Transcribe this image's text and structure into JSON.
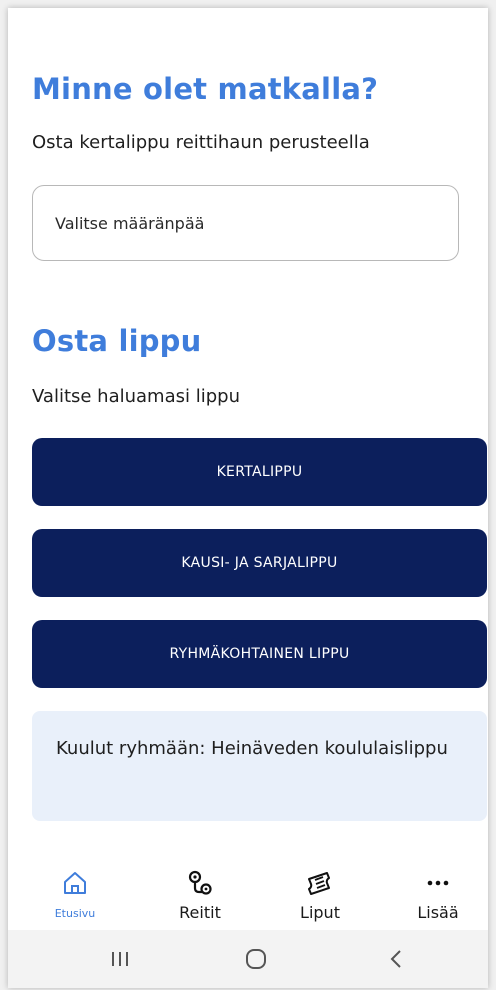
{
  "destination_section": {
    "title": "Minne olet matkalla?",
    "subtitle": "Osta kertalippu reittihaun perusteella",
    "input_placeholder": "Valitse määränpää"
  },
  "ticket_section": {
    "title": "Osta lippu",
    "subtitle": "Valitse haluamasi lippu",
    "buttons": [
      {
        "label": "KERTALIPPU"
      },
      {
        "label": "KAUSI- JA SARJALIPPU"
      },
      {
        "label": "RYHMÄKOHTAINEN LIPPU"
      }
    ],
    "group_info": "Kuulut ryhmään: Heinäveden koululaislippu"
  },
  "bottom_nav": {
    "items": [
      {
        "label": "Etusivu",
        "icon": "home-icon",
        "active": true
      },
      {
        "label": "Reitit",
        "icon": "route-icon",
        "active": false
      },
      {
        "label": "Liput",
        "icon": "ticket-icon",
        "active": false
      },
      {
        "label": "Lisää",
        "icon": "more-icon",
        "active": false
      }
    ]
  },
  "colors": {
    "accent": "#3f7ddb",
    "button_bg": "#0c1f5c",
    "info_bg": "#e9f0fa"
  }
}
